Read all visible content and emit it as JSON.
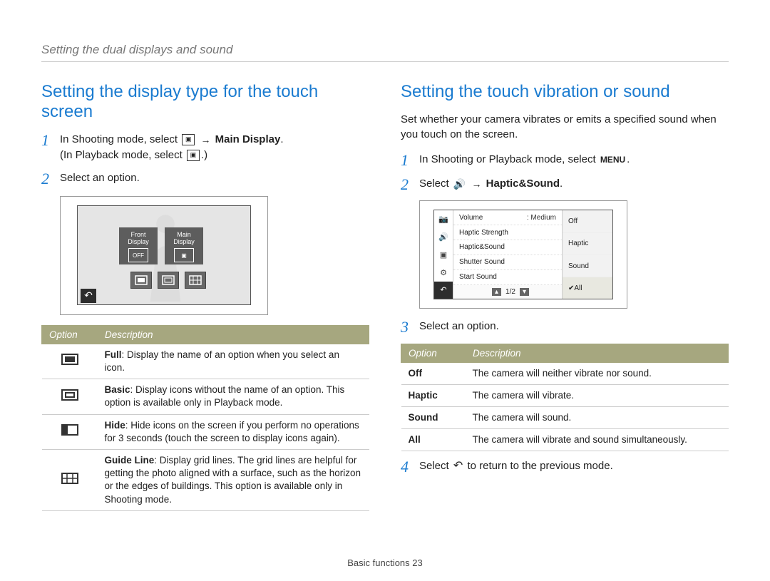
{
  "breadcrumb": "Setting the dual displays and sound",
  "left": {
    "heading": "Setting the display type for the touch screen",
    "step1a": "In Shooting mode, select",
    "step1b": "Main Display",
    "step1c": "In Playback mode, select",
    "step2": "Select an option.",
    "shot": {
      "front_label1": "Front",
      "front_label2": "Display",
      "front_off": "OFF",
      "main_label1": "Main",
      "main_label2": "Display"
    },
    "table": {
      "h1": "Option",
      "h2": "Description",
      "rows": [
        {
          "name": "Full",
          "desc": "Display the name of an option when you select an icon."
        },
        {
          "name": "Basic",
          "desc": "Display icons without the name of an option. This option is available only in Playback mode."
        },
        {
          "name": "Hide",
          "desc": "Hide icons on the screen if you perform no operations for 3 seconds (touch the screen to display icons again)."
        },
        {
          "name": "Guide Line",
          "desc": "Display grid lines. The grid lines are helpful for getting the photo aligned with a surface, such as the horizon or the edges of buildings. This option is available only in Shooting mode."
        }
      ]
    }
  },
  "right": {
    "heading": "Setting the touch vibration or sound",
    "intro": "Set whether your camera vibrates or emits a specified sound when you touch on the screen.",
    "step1": "In Shooting or Playback mode, select",
    "step2a": "Select",
    "step2b": "Haptic&Sound",
    "shot": {
      "name1": "Volume",
      "val1": ": Medium",
      "name2": "Haptic Strength",
      "name3": "Haptic&Sound",
      "name4": "Shutter Sound",
      "name5": "Start Sound",
      "page": "1/2",
      "opt1": "Off",
      "opt2": "Haptic",
      "opt3": "Sound",
      "opt4": "All"
    },
    "step3": "Select an option.",
    "table": {
      "h1": "Option",
      "h2": "Description",
      "rows": [
        {
          "opt": "Off",
          "desc": "The camera will neither vibrate nor sound."
        },
        {
          "opt": "Haptic",
          "desc": "The camera will vibrate."
        },
        {
          "opt": "Sound",
          "desc": "The camera will sound."
        },
        {
          "opt": "All",
          "desc": "The camera will vibrate and sound simultaneously."
        }
      ]
    },
    "step4a": "Select",
    "step4b": "to return to the previous mode."
  },
  "footer": {
    "section": "Basic functions",
    "page": "23"
  }
}
